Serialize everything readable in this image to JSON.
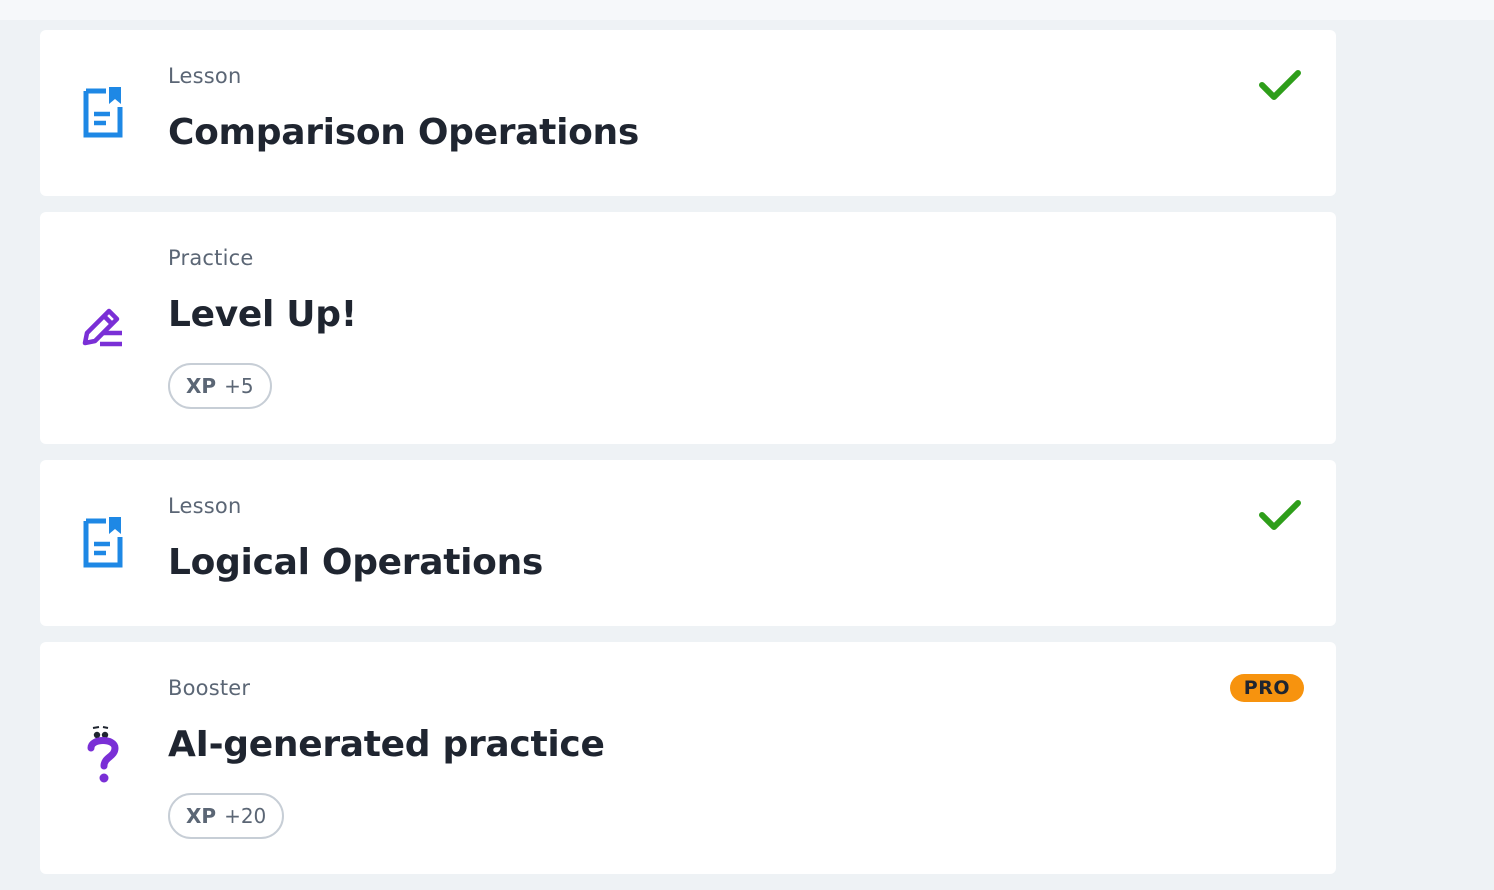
{
  "items": [
    {
      "kind": "Lesson",
      "title": "Comparison Operations",
      "icon": "lesson-icon",
      "status": "completed"
    },
    {
      "kind": "Practice",
      "title": "Level Up!",
      "icon": "practice-icon",
      "xp_label": "XP",
      "xp_value": "+5"
    },
    {
      "kind": "Lesson",
      "title": "Logical Operations",
      "icon": "lesson-icon",
      "status": "completed"
    },
    {
      "kind": "Booster",
      "title": "AI-generated practice",
      "icon": "ai-question-icon",
      "badge": "PRO",
      "xp_label": "XP",
      "xp_value": "+20"
    }
  ],
  "colors": {
    "lesson_icon": "#1e88e5",
    "practice_icon": "#7a2fd6",
    "check": "#2e9e1a",
    "pro_badge": "#f7930e"
  }
}
